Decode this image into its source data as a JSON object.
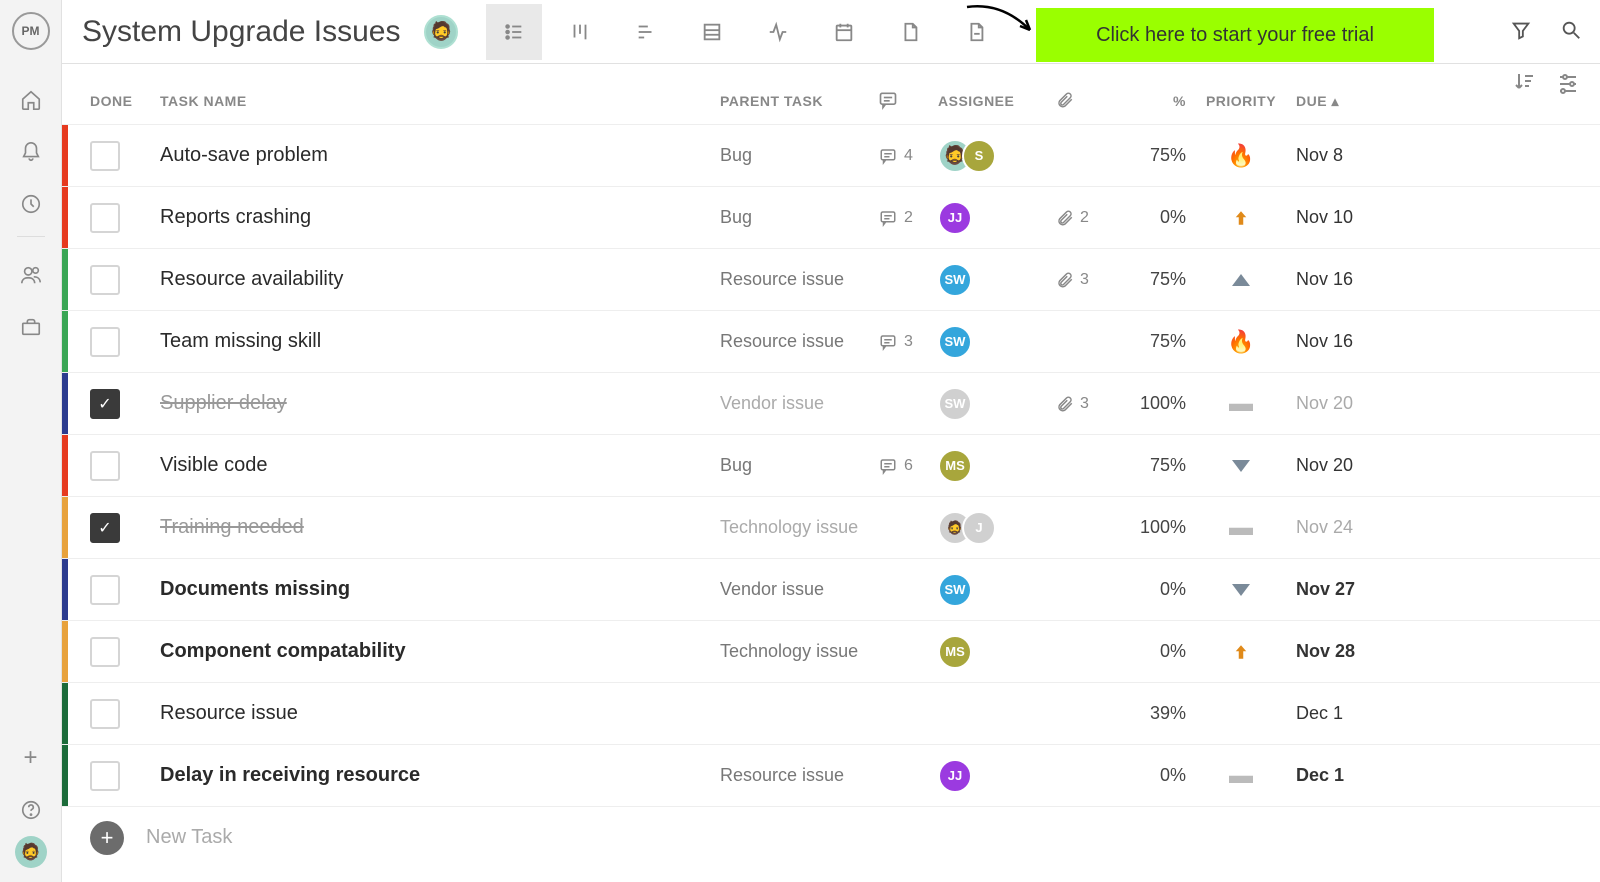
{
  "brand": "PM",
  "title": "System Upgrade Issues",
  "cta": "Click here to start your free trial",
  "newTask": "New Task",
  "columns": {
    "done": "DONE",
    "name": "TASK NAME",
    "parent": "PARENT TASK",
    "assignee": "ASSIGNEE",
    "percent": "%",
    "priority": "PRIORITY",
    "due": "DUE ▴"
  },
  "colors": {
    "red": "#e63a1f",
    "green": "#3aa655",
    "blue": "#2b3b8f",
    "orange": "#e8a23c",
    "darkgreen": "#1c6b3a"
  },
  "tasks": [
    {
      "stripe": "red",
      "done": false,
      "bold": false,
      "name": "Auto-save problem",
      "parent": "Bug",
      "comments": 4,
      "assignees": [
        {
          "t": "bearded",
          "l": "🧔"
        },
        {
          "t": "ms",
          "l": "S"
        }
      ],
      "attach": null,
      "pct": "75%",
      "priority": "fire",
      "due": "Nov 8"
    },
    {
      "stripe": "red",
      "done": false,
      "bold": false,
      "name": "Reports crashing",
      "parent": "Bug",
      "comments": 2,
      "assignees": [
        {
          "t": "jj",
          "l": "JJ"
        }
      ],
      "attach": 2,
      "pct": "0%",
      "priority": "upArrow",
      "due": "Nov 10"
    },
    {
      "stripe": "green",
      "done": false,
      "bold": false,
      "name": "Resource availability",
      "parent": "Resource issue",
      "comments": null,
      "assignees": [
        {
          "t": "sw",
          "l": "SW"
        }
      ],
      "attach": 3,
      "pct": "75%",
      "priority": "triUp",
      "due": "Nov 16"
    },
    {
      "stripe": "green",
      "done": false,
      "bold": false,
      "name": "Team missing skill",
      "parent": "Resource issue",
      "comments": 3,
      "assignees": [
        {
          "t": "sw",
          "l": "SW"
        }
      ],
      "attach": null,
      "pct": "75%",
      "priority": "fire",
      "due": "Nov 16"
    },
    {
      "stripe": "blue",
      "done": true,
      "bold": false,
      "name": "Supplier delay",
      "parent": "Vendor issue",
      "comments": null,
      "assignees": [
        {
          "t": "gray",
          "l": "SW"
        }
      ],
      "attach": 3,
      "pct": "100%",
      "priority": "dash",
      "due": "Nov 20"
    },
    {
      "stripe": "red",
      "done": false,
      "bold": false,
      "name": "Visible code",
      "parent": "Bug",
      "comments": 6,
      "assignees": [
        {
          "t": "ms",
          "l": "MS"
        }
      ],
      "attach": null,
      "pct": "75%",
      "priority": "triDown",
      "due": "Nov 20"
    },
    {
      "stripe": "orange",
      "done": true,
      "bold": false,
      "name": "Training needed",
      "parent": "Technology issue",
      "comments": null,
      "assignees": [
        {
          "t": "gray",
          "l": "🧔"
        },
        {
          "t": "gray",
          "l": "J"
        }
      ],
      "attach": null,
      "pct": "100%",
      "priority": "dash",
      "due": "Nov 24"
    },
    {
      "stripe": "blue",
      "done": false,
      "bold": true,
      "name": "Documents missing",
      "parent": "Vendor issue",
      "comments": null,
      "assignees": [
        {
          "t": "sw",
          "l": "SW"
        }
      ],
      "attach": null,
      "pct": "0%",
      "priority": "triDown",
      "due": "Nov 27"
    },
    {
      "stripe": "orange",
      "done": false,
      "bold": true,
      "name": "Component compatability",
      "parent": "Technology issue",
      "comments": null,
      "assignees": [
        {
          "t": "ms",
          "l": "MS"
        }
      ],
      "attach": null,
      "pct": "0%",
      "priority": "upArrow",
      "due": "Nov 28"
    },
    {
      "stripe": "darkgreen",
      "done": false,
      "bold": false,
      "name": "Resource issue",
      "parent": "",
      "comments": null,
      "assignees": [],
      "attach": null,
      "pct": "39%",
      "priority": "",
      "due": "Dec 1"
    },
    {
      "stripe": "darkgreen",
      "done": false,
      "bold": true,
      "name": "Delay in receiving resource",
      "parent": "Resource issue",
      "comments": null,
      "assignees": [
        {
          "t": "jj",
          "l": "JJ"
        }
      ],
      "attach": null,
      "pct": "0%",
      "priority": "dash",
      "due": "Dec 1"
    }
  ]
}
